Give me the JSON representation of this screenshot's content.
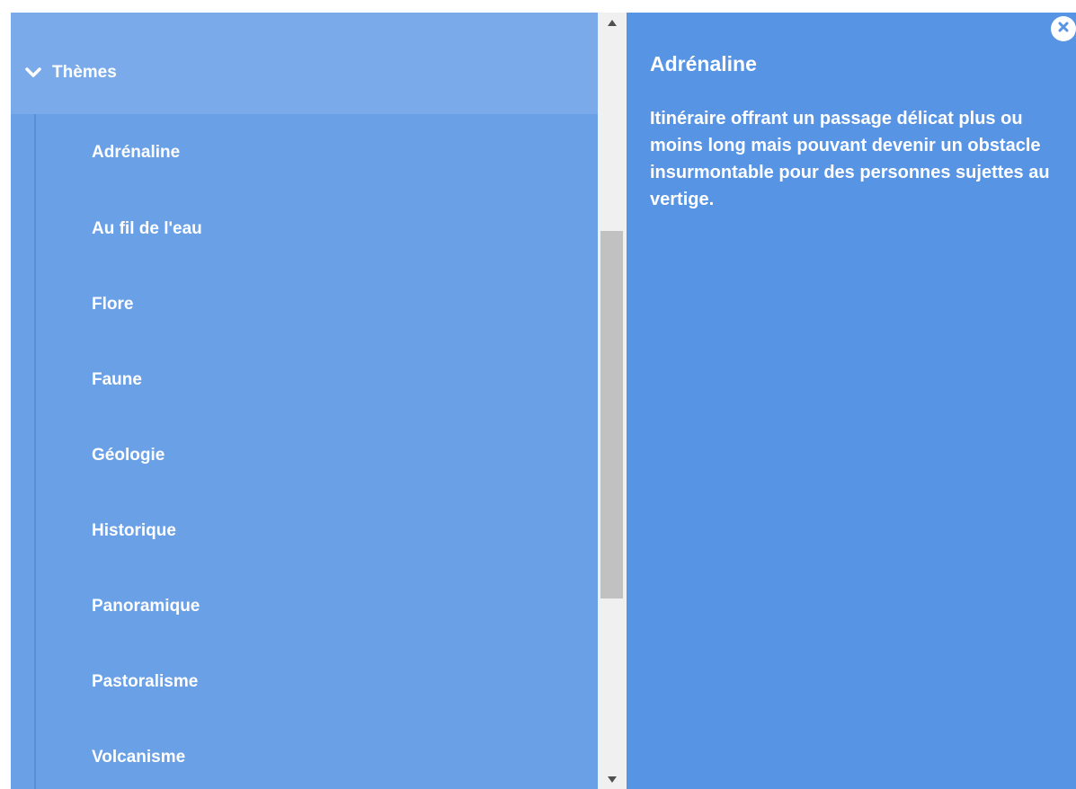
{
  "menu": {
    "section_title": "Thèmes",
    "items": [
      {
        "label": "Adrénaline"
      },
      {
        "label": "Au fil de l'eau"
      },
      {
        "label": "Flore"
      },
      {
        "label": "Faune"
      },
      {
        "label": "Géologie"
      },
      {
        "label": "Historique"
      },
      {
        "label": "Panoramique"
      },
      {
        "label": "Pastoralisme"
      },
      {
        "label": "Volcanisme"
      }
    ]
  },
  "info": {
    "title": "Adrénaline",
    "description": "Itinéraire offrant un passage délicat plus ou moins long mais pouvant devenir un obstacle insurmontable pour des personnes sujettes au vertige."
  },
  "icons": {
    "section_toggle": "chevron-down-icon",
    "close": "close-icon",
    "scroll_up": "scroll-up-arrow-icon",
    "scroll_down": "scroll-down-arrow-icon"
  },
  "colors": {
    "menu_bg": "#6aa0e6",
    "header_bg": "#7aaaea",
    "info_bg": "#5894e4",
    "text": "#ffffff"
  }
}
